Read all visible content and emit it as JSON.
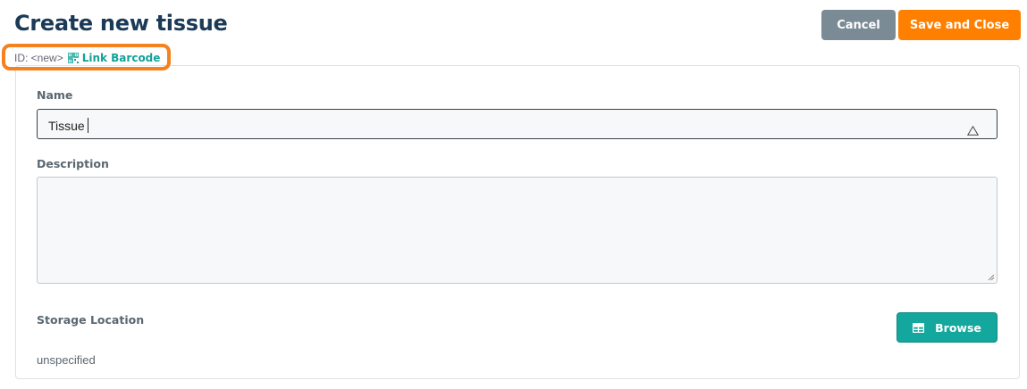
{
  "header": {
    "title": "Create new tissue",
    "cancel_label": "Cancel",
    "save_label": "Save and Close"
  },
  "id_row": {
    "id_text": "ID: <new>",
    "link_barcode_label": "Link Barcode",
    "icon": "qr-code-icon"
  },
  "form": {
    "name": {
      "label": "Name",
      "value": "Tissue",
      "icon": "warning-triangle-icon"
    },
    "description": {
      "label": "Description",
      "value": ""
    },
    "storage_location": {
      "label": "Storage Location",
      "value": "unspecified",
      "browse_label": "Browse",
      "browse_icon": "grid-table-icon"
    }
  },
  "colors": {
    "title": "#1b3a57",
    "cancel": "#7b8b96",
    "save": "#ff8000",
    "accent_teal": "#13a79d",
    "highlight": "#f6811f"
  }
}
